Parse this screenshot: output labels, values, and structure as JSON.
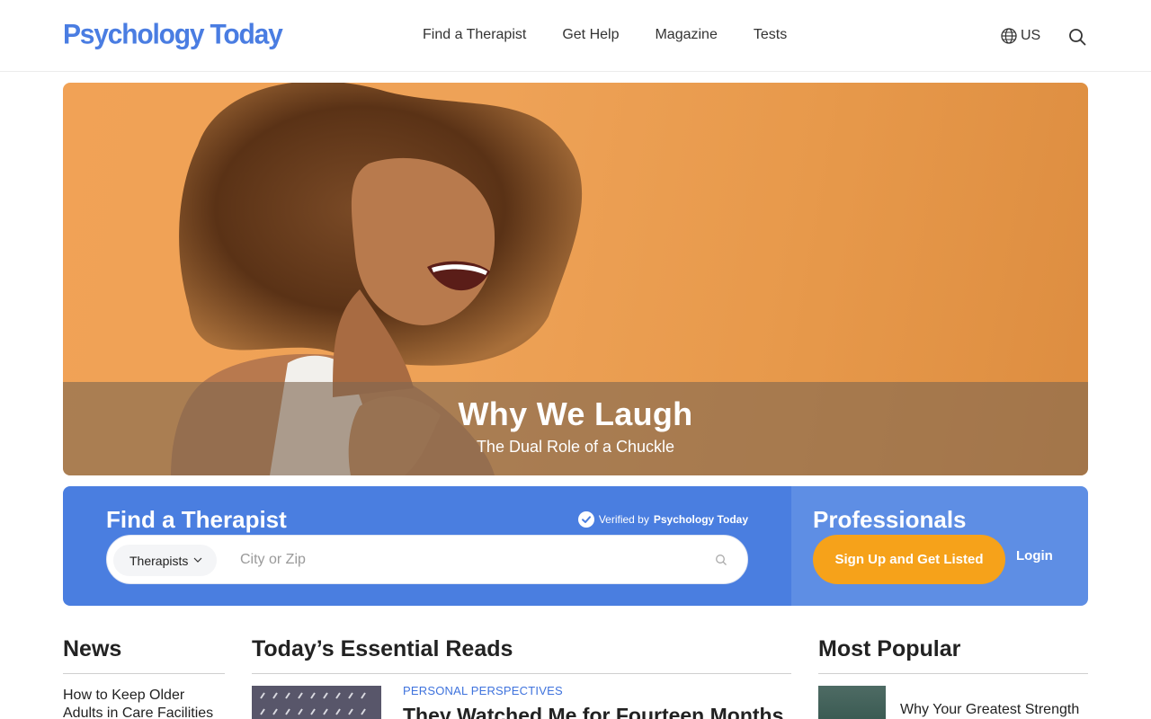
{
  "header": {
    "logo": "Psychology Today",
    "nav": [
      {
        "label": "Find a Therapist"
      },
      {
        "label": "Get Help"
      },
      {
        "label": "Magazine"
      },
      {
        "label": "Tests"
      }
    ],
    "locale": "US"
  },
  "hero": {
    "title": "Why We Laugh",
    "subtitle": "The Dual Role of a Chuckle"
  },
  "find_therapist": {
    "title": "Find a Therapist",
    "verified_prefix": "Verified by",
    "verified_brand": "Psychology Today",
    "type_select": "Therapists",
    "city_placeholder": "City or Zip"
  },
  "professionals": {
    "title": "Professionals",
    "signup_label": "Sign Up and Get Listed",
    "login_label": "Login"
  },
  "news": {
    "title": "News",
    "items": [
      {
        "text": "How to Keep Older Adults in Care Facilities"
      }
    ]
  },
  "essential_reads": {
    "title": "Today’s Essential Reads",
    "items": [
      {
        "category": "Personal Perspectives",
        "headline": "They Watched Me for Fourteen Months"
      }
    ]
  },
  "most_popular": {
    "title": "Most Popular",
    "items": [
      {
        "title": "Why Your Greatest Strength"
      }
    ]
  },
  "colors": {
    "brand_blue": "#4a7ee0",
    "accent_orange": "#f6a21a",
    "hero_bg": "#eea257"
  }
}
